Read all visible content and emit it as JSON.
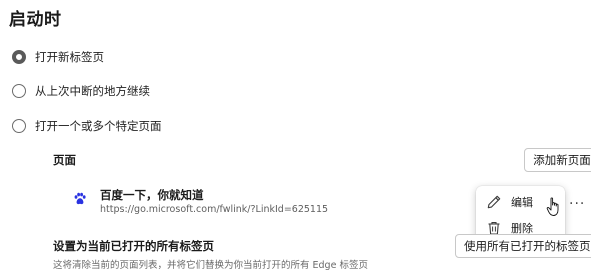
{
  "section": {
    "title": "启动时"
  },
  "startup_options": [
    {
      "label": "打开新标签页",
      "checked": true
    },
    {
      "label": "从上次中断的地方继续",
      "checked": false
    },
    {
      "label": "打开一个或多个特定页面",
      "checked": false
    }
  ],
  "pages": {
    "label": "页面",
    "add_button": "添加新页面",
    "items": [
      {
        "title": "百度一下，你就知道",
        "url": "https://go.microsoft.com/fwlink/?LinkId=625115",
        "icon": "baidu-paw-icon"
      }
    ],
    "more_icon": "···"
  },
  "context_menu": {
    "items": [
      {
        "label": "编辑",
        "icon": "pencil-icon"
      },
      {
        "label": "删除",
        "icon": "trash-icon"
      }
    ]
  },
  "use_current": {
    "label": "设置为当前已打开的所有标签页",
    "description": "这将清除当前的页面列表，并将它们替换为你当前打开的所有 Edge 标签页",
    "button": "使用所有已打开的标签页"
  },
  "colors": {
    "baidu_blue": "#2932e1",
    "radio_checked": "#5a5a5a"
  }
}
